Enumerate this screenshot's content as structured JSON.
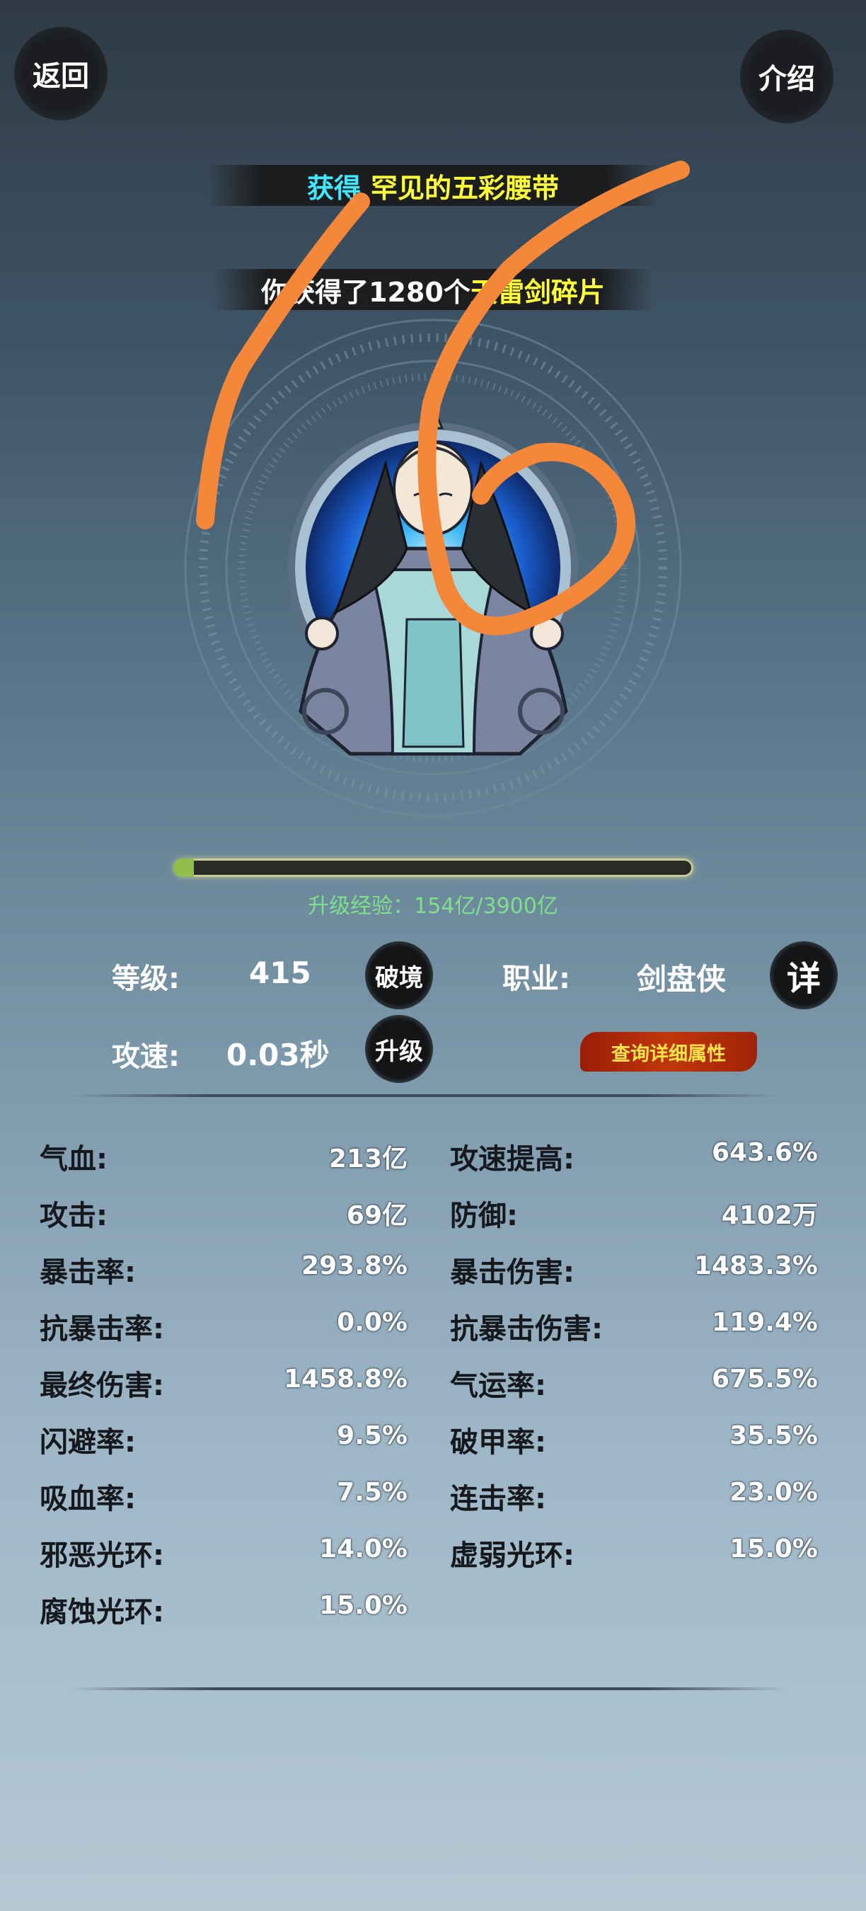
{
  "header": {
    "back_label": "返回",
    "intro_label": "介绍"
  },
  "banners": {
    "obtain_prefix": "获得",
    "obtain_item": "罕见的五彩腰带",
    "fragments_prefix": "你获得了1280个",
    "fragments_item": "天雷剑碎片"
  },
  "experience": {
    "label": "升级经验：154亿/3900亿",
    "progress": 0.039
  },
  "info": {
    "level_label": "等级:",
    "level_value": "415",
    "breakthrough_label": "破境",
    "class_label": "职业:",
    "class_value": "剑盘侠",
    "detail_label": "详",
    "speed_label": "攻速:",
    "speed_value": "0.03秒",
    "upgrade_label": "升级",
    "query_label": "查询详细属性"
  },
  "stats": {
    "left": [
      {
        "label": "气血:",
        "value": "213亿"
      },
      {
        "label": "攻击:",
        "value": "69亿"
      },
      {
        "label": "暴击率:",
        "value": "293.8%"
      },
      {
        "label": "抗暴击率:",
        "value": "0.0%"
      },
      {
        "label": "最终伤害:",
        "value": "1458.8%"
      },
      {
        "label": "闪避率:",
        "value": "9.5%"
      },
      {
        "label": "吸血率:",
        "value": "7.5%"
      },
      {
        "label": "邪恶光环:",
        "value": "14.0%"
      },
      {
        "label": "腐蚀光环:",
        "value": "15.0%"
      }
    ],
    "right": [
      {
        "label": "攻速提高:",
        "value": "643.6%"
      },
      {
        "label": "防御:",
        "value": "4102万"
      },
      {
        "label": "暴击伤害:",
        "value": "1483.3%"
      },
      {
        "label": "抗暴击伤害:",
        "value": "119.4%"
      },
      {
        "label": "气运率:",
        "value": "675.5%"
      },
      {
        "label": "破甲率:",
        "value": "35.5%"
      },
      {
        "label": "连击率:",
        "value": "23.0%"
      },
      {
        "label": "虚弱光环:",
        "value": "15.0%"
      }
    ]
  },
  "colors": {
    "cyan_text": "#3fe8ff",
    "yellow_text": "#ffff3a",
    "exp_green": "#7ee08a",
    "annotation_orange": "#f5873a"
  },
  "icons": {
    "character": "meditating-swordsman-portrait",
    "annotation": "handwritten-16-annotation"
  }
}
